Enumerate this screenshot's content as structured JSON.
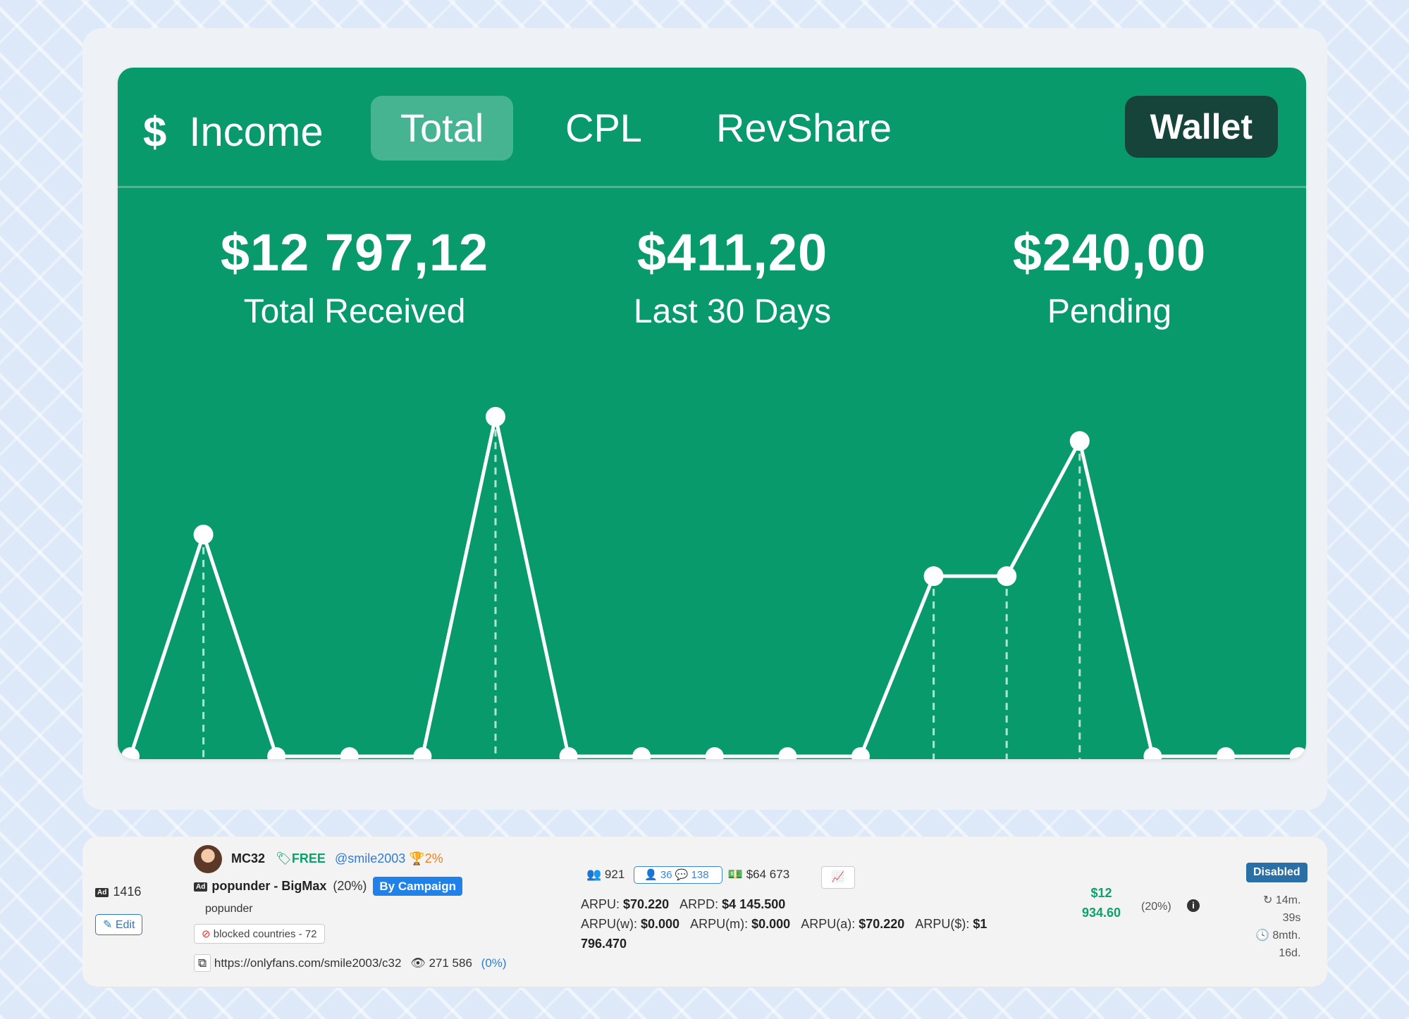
{
  "income": {
    "title": "Income",
    "currency_symbol": "$",
    "tabs": [
      "Total",
      "CPL",
      "RevShare"
    ],
    "active_tab": "Total",
    "wallet_label": "Wallet",
    "stats": [
      {
        "amount": "$12 797,12",
        "label": "Total Received"
      },
      {
        "amount": "$411,20",
        "label": "Last 30 Days"
      },
      {
        "amount": "$240,00",
        "label": "Pending"
      }
    ]
  },
  "chart_data": {
    "type": "line",
    "x": [
      1,
      2,
      3,
      4,
      5,
      6,
      7,
      8,
      9,
      10,
      11,
      12,
      13,
      14,
      15,
      16,
      17
    ],
    "values": [
      0,
      64,
      0,
      0,
      0,
      98,
      0,
      0,
      0,
      0,
      0,
      52,
      52,
      91,
      0,
      0,
      0
    ],
    "series": [
      {
        "name": "",
        "values": [
          0,
          64,
          0,
          0,
          0,
          98,
          0,
          0,
          0,
          0,
          0,
          52,
          52,
          91,
          0,
          0,
          0
        ]
      }
    ],
    "ylim": [
      0,
      100
    ],
    "grid": false,
    "colors": {
      "line": "#ffffff",
      "background": "#089a6b"
    }
  },
  "campaign": {
    "id": "1416",
    "edit_label": "Edit",
    "owner": "MC32",
    "price_tag": "FREE",
    "handle": "@smile2003",
    "trophy_pct": "2%",
    "name": "popunder - BigMax",
    "name_pct": "(20%)",
    "by_campaign_label": "By Campaign",
    "type": "popunder",
    "blocked": "blocked countries - 72",
    "url": "https://onlyfans.com/smile2003/c32",
    "views": "271 586",
    "views_pct": "(0%)",
    "users": "921",
    "subs": "36",
    "messages": "138",
    "revenue": "$64 673",
    "arpu_label": "ARPU:",
    "arpu": "$70.220",
    "arpd_label": "ARPD:",
    "arpd": "$4 145.500",
    "arpuw_label": "ARPU(w):",
    "arpuw": "$0.000",
    "arpum_label": "ARPU(m):",
    "arpum": "$0.000",
    "arpua_label": "ARPU(a):",
    "arpua": "$70.220",
    "arpud_label": "ARPU($):",
    "arpud_1": "$1",
    "arpud_2": "796.470",
    "earned_1": "$12",
    "earned_2": "934.60",
    "earned_pct": "(20%)",
    "status": "Disabled",
    "refresh_1": "14m.",
    "refresh_2": "39s",
    "age_1": "8mth.",
    "age_2": "16d."
  },
  "colors": {
    "panel": "#089a6b",
    "wallet": "#16433a",
    "accent_blue": "#2082e8"
  }
}
